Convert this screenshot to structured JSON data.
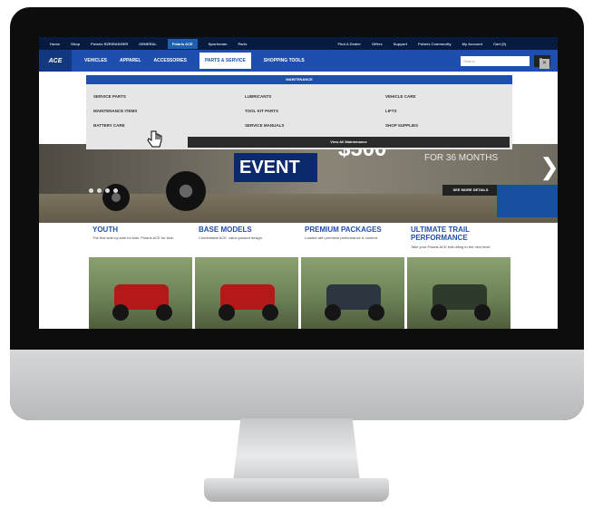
{
  "topbar": {
    "items": [
      "Home",
      "Shop",
      "Polaris RZR/RANGER",
      "GENERAL",
      "Polaris ACE",
      "Sportsman",
      "Parts",
      "Find A Dealer",
      "Offers",
      "Support",
      "Polaris Community",
      "My Account",
      "Cart (0)"
    ],
    "active_index": 4
  },
  "navbar": {
    "logo": "ACE",
    "items": [
      "VEHICLES",
      "APPAREL",
      "ACCESSORIES",
      "PARTS & SERVICE",
      "SHOPPING TOOLS"
    ],
    "selected_index": 3,
    "search_placeholder": "Search",
    "search_button": "Go"
  },
  "menu": {
    "heading": "MAINTENANCE",
    "items": [
      "SERVICE PARTS",
      "LUBRICANTS",
      "VEHICLE CARE",
      "MAINTENANCE ITEMS",
      "TOOL KIT PARTS",
      "LIFTS",
      "BATTERY CARE",
      "SERVICE MANUALS",
      "SHOP SUPPLIES"
    ],
    "view_all": "View All Maintenance"
  },
  "hero": {
    "headline": "EVENT",
    "price": "$500",
    "term": "FOR 36 MONTHS",
    "cta": "SEE MORE DETAILS",
    "next_icon": "chevron-right-icon"
  },
  "cards": [
    {
      "title": "YOUTH",
      "desc": "The first side-by-side for kids. Polaris ACE for kids."
    },
    {
      "title": "BASE MODELS",
      "desc": "Comfortable ACE, value-packed design."
    },
    {
      "title": "PREMIUM PACKAGES",
      "desc": "Loaded with premium performance & comfort."
    },
    {
      "title": "ULTIMATE TRAIL PERFORMANCE",
      "desc": "Take your Polaris ACE trail riding to the next level."
    }
  ],
  "colors": {
    "brand_blue": "#1e4fb0",
    "navy": "#071a3f"
  }
}
